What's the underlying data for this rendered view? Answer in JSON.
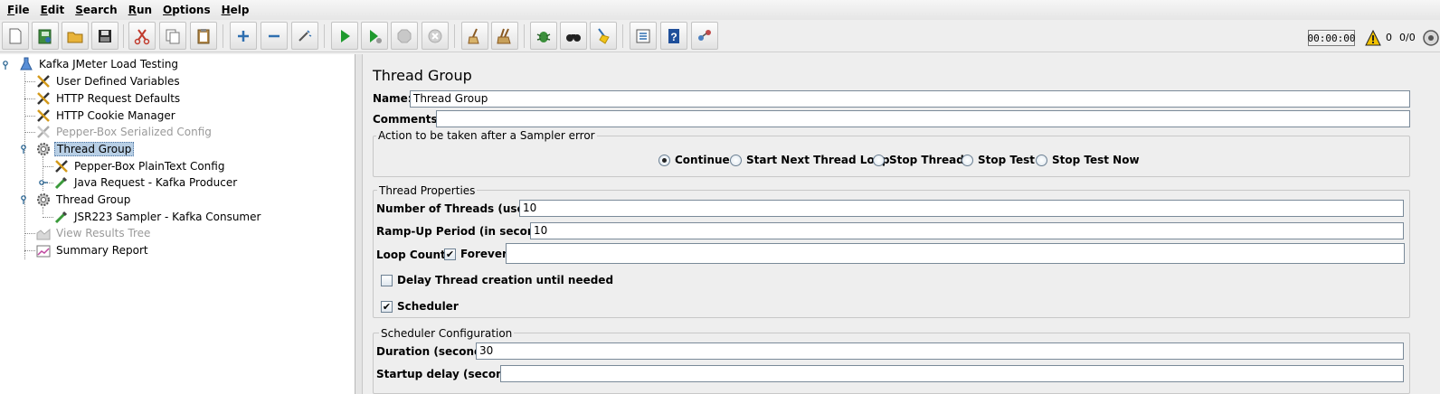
{
  "menu": [
    {
      "mnemonic": "F",
      "rest": "ile"
    },
    {
      "mnemonic": "E",
      "rest": "dit"
    },
    {
      "mnemonic": "S",
      "rest": "earch"
    },
    {
      "mnemonic": "R",
      "rest": "un"
    },
    {
      "mnemonic": "O",
      "rest": "ptions"
    },
    {
      "mnemonic": "H",
      "rest": "elp"
    }
  ],
  "toolbar": {
    "timer": "00:00:00",
    "warning_count": "0",
    "thread_count": "0/0"
  },
  "tree": {
    "items": [
      {
        "label": "Kafka JMeter Load Testing",
        "icon": "test-plan-icon",
        "state": "enabled"
      },
      {
        "label": "User Defined Variables",
        "icon": "config-wrench-icon",
        "state": "enabled"
      },
      {
        "label": "HTTP Request Defaults",
        "icon": "config-wrench-icon",
        "state": "enabled"
      },
      {
        "label": "HTTP Cookie Manager",
        "icon": "config-wrench-icon",
        "state": "enabled"
      },
      {
        "label": "Pepper-Box Serialized Config",
        "icon": "config-wrench-icon",
        "state": "disabled"
      },
      {
        "label": "Thread Group",
        "icon": "gear-icon",
        "state": "selected"
      },
      {
        "label": "Pepper-Box PlainText Config",
        "icon": "config-wrench-icon",
        "state": "enabled"
      },
      {
        "label": "Java Request - Kafka Producer",
        "icon": "sampler-pipette-icon",
        "state": "enabled"
      },
      {
        "label": "Thread Group",
        "icon": "gear-icon",
        "state": "enabled"
      },
      {
        "label": "JSR223 Sampler - Kafka Consumer",
        "icon": "sampler-pipette-icon",
        "state": "enabled"
      },
      {
        "label": "View Results Tree",
        "icon": "listener-chart-icon",
        "state": "disabled"
      },
      {
        "label": "Summary Report",
        "icon": "listener-chart-icon",
        "state": "enabled"
      }
    ]
  },
  "panel": {
    "title": "Thread Group",
    "name_label": "Name:",
    "name_value": "Thread Group",
    "comments_label": "Comments:",
    "comments_value": "",
    "sampler_error": {
      "legend": "Action to be taken after a Sampler error",
      "options": [
        "Continue",
        "Start Next Thread Loop",
        "Stop Thread",
        "Stop Test",
        "Stop Test Now"
      ],
      "selected": "Continue"
    },
    "thread_props": {
      "legend": "Thread Properties",
      "threads_label": "Number of Threads (users):",
      "threads_value": "10",
      "rampup_label": "Ramp-Up Period (in seconds):",
      "rampup_value": "10",
      "loop_label": "Loop Count:",
      "forever_label": "Forever",
      "forever_checked": true,
      "loop_value": "",
      "delay_label": "Delay Thread creation until needed",
      "delay_checked": false,
      "scheduler_label": "Scheduler",
      "scheduler_checked": true
    },
    "scheduler": {
      "legend": "Scheduler Configuration",
      "duration_label": "Duration (seconds)",
      "duration_value": "30",
      "startup_label": "Startup delay (seconds)",
      "startup_value": ""
    }
  }
}
